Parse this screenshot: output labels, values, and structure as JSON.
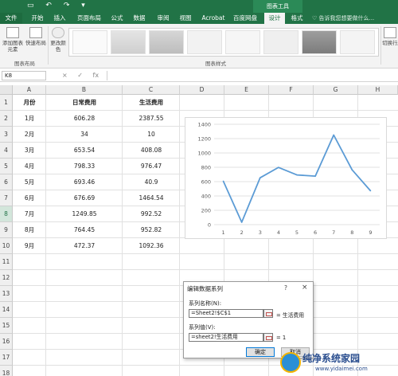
{
  "quick_access": {
    "save_icon": "save-icon",
    "undo_icon": "undo-icon",
    "redo_icon": "redo-icon",
    "customize_icon": "customize-icon"
  },
  "context_title": "图表工具",
  "tabs": [
    "文件",
    "开始",
    "插入",
    "页面布局",
    "公式",
    "数据",
    "审阅",
    "视图",
    "Acrobat",
    "百度网盘",
    "设计",
    "格式"
  ],
  "active_tab": "设计",
  "tell_me": "告诉我您想要做什么...",
  "ribbon": {
    "add_element": "添加图表元素",
    "quick_layout": "快速布局",
    "change_colors": "更改颜色",
    "layout_group": "图表布局",
    "styles_group": "图表样式",
    "switch_row_col": "切换行/列"
  },
  "name_box": "K8",
  "formula_icons": [
    "×",
    "✓",
    "fx"
  ],
  "columns": [
    "A",
    "B",
    "C",
    "D",
    "E",
    "F",
    "G",
    "H"
  ],
  "rows": [
    "1",
    "2",
    "3",
    "4",
    "5",
    "6",
    "7",
    "8",
    "9",
    "10",
    "11",
    "12",
    "13",
    "14",
    "15",
    "16",
    "17",
    "18"
  ],
  "selected_row": "8",
  "table": {
    "headers": [
      "月份",
      "日常费用",
      "生活费用"
    ],
    "data": [
      [
        "1月",
        "606.28",
        "2387.55"
      ],
      [
        "2月",
        "34",
        "10"
      ],
      [
        "3月",
        "653.54",
        "408.08"
      ],
      [
        "4月",
        "798.33",
        "976.47"
      ],
      [
        "5月",
        "693.46",
        "40.9"
      ],
      [
        "6月",
        "676.69",
        "1464.54"
      ],
      [
        "7月",
        "1249.85",
        "992.52"
      ],
      [
        "8月",
        "764.45",
        "952.82"
      ],
      [
        "9月",
        "472.37",
        "1092.36"
      ]
    ]
  },
  "chart_data": {
    "type": "line",
    "categories": [
      "1",
      "2",
      "3",
      "4",
      "5",
      "6",
      "7",
      "8",
      "9"
    ],
    "series": [
      {
        "values": [
          606.28,
          34,
          653.54,
          798.33,
          693.46,
          676.69,
          1249.85,
          764.45,
          472.37
        ],
        "color": "#5b9bd5"
      }
    ],
    "yticks": [
      "0",
      "200",
      "400",
      "600",
      "800",
      "1000",
      "1200",
      "1400"
    ],
    "ylim": [
      0,
      1400
    ],
    "grid": true
  },
  "dialog": {
    "title": "编辑数据系列",
    "help": "?",
    "close": "×",
    "name_label": "系列名称(N):",
    "name_value": "=Sheet2!$C$1",
    "name_preview": "= 生活费用",
    "values_label": "系列值(V):",
    "values_value": "=sheet2!生活费用",
    "values_preview": "= 1",
    "ok": "确定",
    "cancel": "取消"
  },
  "watermark": {
    "text": "纯净系统家园",
    "url": "www.yidaimei.com"
  }
}
